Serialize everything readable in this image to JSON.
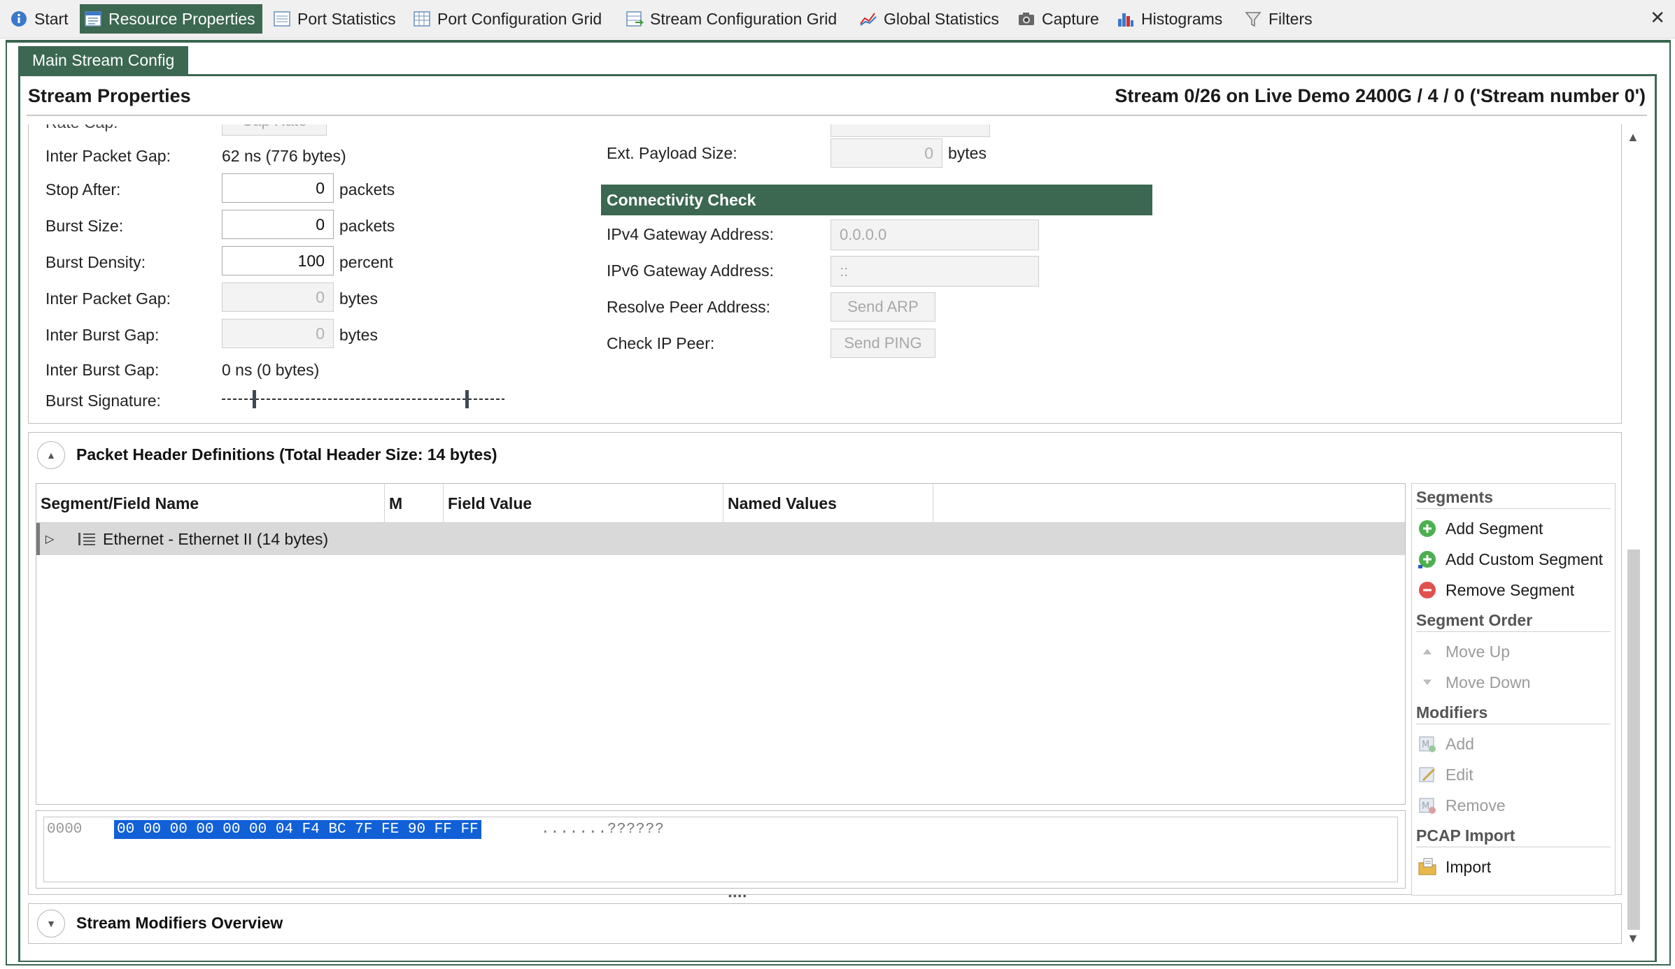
{
  "tabs": [
    {
      "label": "Start",
      "icon": "info-icon"
    },
    {
      "label": "Resource Properties",
      "icon": "properties-icon",
      "active": true
    },
    {
      "label": "Port Statistics",
      "icon": "table-icon"
    },
    {
      "label": "Port Configuration Grid",
      "icon": "grid-icon"
    },
    {
      "label": "Stream Configuration Grid",
      "icon": "grid-arrow-icon"
    },
    {
      "label": "Global Statistics",
      "icon": "line-chart-icon"
    },
    {
      "label": "Capture",
      "icon": "camera-icon"
    },
    {
      "label": "Histograms",
      "icon": "histogram-icon"
    },
    {
      "label": "Filters",
      "icon": "funnel-icon"
    }
  ],
  "close_label": "✕",
  "config_tab": "Main Stream Config",
  "header": {
    "title": "Stream Properties",
    "stream_id": "Stream 0/26 on Live Demo 2400G / 4 / 0 ('Stream number 0')"
  },
  "rate": {
    "rate_cap_label": "Rate Cap:",
    "rate_cap_button": "Cap Rate",
    "inter_packet_gap_label": "Inter Packet Gap:",
    "inter_packet_gap_value": "62 ns (776 bytes)",
    "stop_after_label": "Stop After:",
    "stop_after_value": "0",
    "stop_after_unit": "packets",
    "burst_size_label": "Burst Size:",
    "burst_size_value": "0",
    "burst_size_unit": "packets",
    "burst_density_label": "Burst Density:",
    "burst_density_value": "100",
    "burst_density_unit": "percent",
    "ipg_bytes_label": "Inter Packet Gap:",
    "ipg_bytes_value": "0",
    "ipg_bytes_unit": "bytes",
    "ibg_bytes_label": "Inter Burst Gap:",
    "ibg_bytes_value": "0",
    "ibg_bytes_unit": "bytes",
    "ibg_time_label": "Inter Burst Gap:",
    "ibg_time_value": "0 ns (0 bytes)",
    "burst_signature_label": "Burst Signature:"
  },
  "payload": {
    "ext_payload_label": "Ext. Payload Size:",
    "ext_payload_value": "0",
    "ext_payload_unit": "bytes"
  },
  "connectivity": {
    "title": "Connectivity Check",
    "ipv4_label": "IPv4 Gateway Address:",
    "ipv4_value": "0.0.0.0",
    "ipv6_label": "IPv6 Gateway Address:",
    "ipv6_value": "::",
    "resolve_label": "Resolve Peer Address:",
    "resolve_button": "Send ARP",
    "check_label": "Check IP Peer:",
    "check_button": "Send PING"
  },
  "packet_headers": {
    "title": "Packet Header Definitions (Total Header Size: 14 bytes)",
    "columns": [
      "Segment/Field Name",
      "M",
      "Field Value",
      "Named Values"
    ],
    "rows": [
      {
        "name": "Ethernet - Ethernet II (14 bytes)"
      }
    ],
    "hex_offset": "0000",
    "hex_bytes": "00 00 00 00 00 00 04 F4 BC 7F FE 90 FF FF",
    "hex_ascii": ".......??????"
  },
  "actions": {
    "segments_title": "Segments",
    "add_segment": "Add Segment",
    "add_custom_segment": "Add Custom Segment",
    "remove_segment": "Remove Segment",
    "order_title": "Segment Order",
    "move_up": "Move Up",
    "move_down": "Move Down",
    "modifiers_title": "Modifiers",
    "mod_add": "Add",
    "mod_edit": "Edit",
    "mod_remove": "Remove",
    "pcap_title": "PCAP Import",
    "import": "Import"
  },
  "modifiers_overview": {
    "title": "Stream Modifiers Overview"
  },
  "colors": {
    "accent": "#3c6751",
    "selection": "#1160d8"
  }
}
